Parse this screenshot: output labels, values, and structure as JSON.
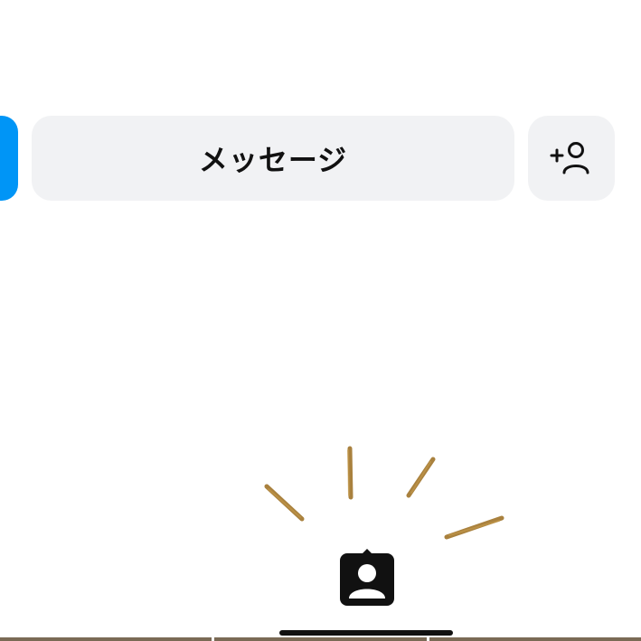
{
  "profile_actions": {
    "message_label": "メッセージ",
    "add_person_icon": "add-person-icon"
  },
  "bottom_nav": {
    "active_tab_icon": "profile-tab-icon"
  },
  "colors": {
    "follow_button": "#0095f6",
    "secondary_button_bg": "#f1f2f4",
    "text": "#111111",
    "sparkle": "#a0742a"
  }
}
